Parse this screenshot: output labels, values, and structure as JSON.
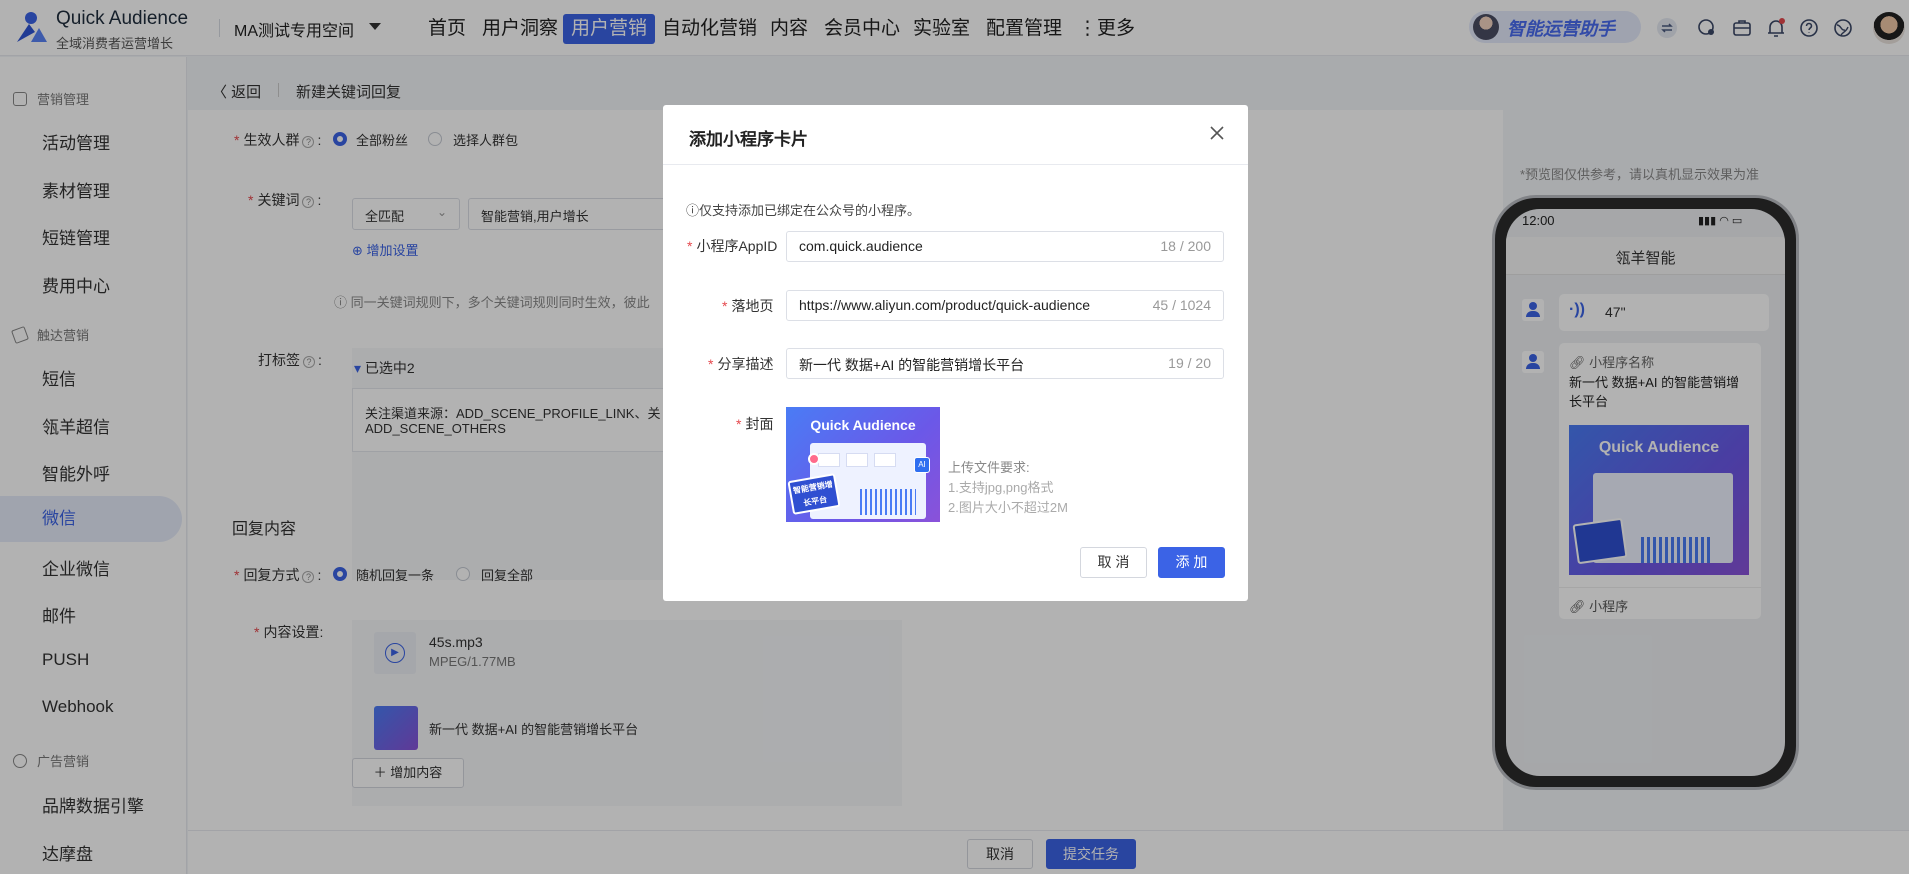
{
  "app": {
    "brand": "Quick Audience",
    "subtitle": "全域消费者运营增长",
    "workspace": "MA测试专用空间",
    "nav": [
      "首页",
      "用户洞察",
      "用户营销",
      "自动化营销",
      "内容",
      "会员中心",
      "实验室",
      "配置管理",
      "⋮更多"
    ],
    "nav_active": "用户营销",
    "assistant": "智能运营助手"
  },
  "sidebar": {
    "group_marketing": "营销管理",
    "marketing_items": [
      "活动管理",
      "素材管理",
      "短链管理",
      "费用中心"
    ],
    "group_reach": "触达营销",
    "reach_items": [
      "短信",
      "瓴羊超信",
      "智能外呼",
      "微信",
      "企业微信",
      "邮件",
      "PUSH",
      "Webhook"
    ],
    "active_item": "微信",
    "group_ads": "广告营销",
    "ads_items": [
      "品牌数据引擎",
      "达摩盘"
    ]
  },
  "page": {
    "back": "返回",
    "title": "新建关键词回复",
    "audience_label": "生效人群",
    "audience_all": "全部粉丝",
    "audience_select": "选择人群包",
    "keyword_label": "关键词",
    "match_mode": "全匹配",
    "keywords": "智能营销,用户增长",
    "add_setting": "增加设置",
    "keyword_note": "同一关键词规则下，多个关键词规则同时生效，彼此",
    "tag_label": "打标签",
    "tag_selected": "已选中2",
    "tag_text_1": "关注渠道来源：ADD_SCENE_PROFILE_LINK、关",
    "tag_text_2": "ADD_SCENE_OTHERS",
    "reply_section": "回复内容",
    "reply_mode_label": "回复方式",
    "reply_random": "随机回复一条",
    "reply_all": "回复全部",
    "content_label": "内容设置:",
    "audio_name": "45s.mp3",
    "audio_meta": "MPEG/1.77MB",
    "mini_title": "新一代 数据+AI 的智能营销增长平台",
    "add_content": "增加内容",
    "cancel": "取消",
    "submit": "提交任务"
  },
  "modal": {
    "title": "添加小程序卡片",
    "tip": "仅支持添加已绑定在公众号的小程序。",
    "appid_label": "小程序AppID",
    "appid_value": "com.quick.audience",
    "appid_count": "18 / 200",
    "landing_label": "落地页",
    "landing_value": "https://www.aliyun.com/product/quick-audience",
    "landing_count": "45 / 1024",
    "desc_label": "分享描述",
    "desc_value": "新一代 数据+AI 的智能营销增长平台",
    "desc_count": "19 / 20",
    "cover_label": "封面",
    "cover_brand": "Quick Audience",
    "cover_badge": "智能营销增长平台",
    "upload_title": "上传文件要求:",
    "upload_rule1": "1.支持jpg,png格式",
    "upload_rule2": "2.图片大小不超过2M",
    "cancel": "取 消",
    "add": "添 加"
  },
  "preview": {
    "note": "*预览图仅供参考，请以真机显示效果为准",
    "time": "12:00",
    "account": "瓴羊智能",
    "voice_len": "47\"",
    "mini_name_label": "小程序名称",
    "mini_desc": "新一代 数据+AI 的智能营销增长平台",
    "mini_desc_line1": "新一代 数据+AI 的智能营销增",
    "mini_desc_line2": "长平台",
    "cover_brand": "Quick Audience",
    "mini_footer": "小程序"
  },
  "colors": {
    "primary": "#3b63e6",
    "required": "#e5484d"
  }
}
